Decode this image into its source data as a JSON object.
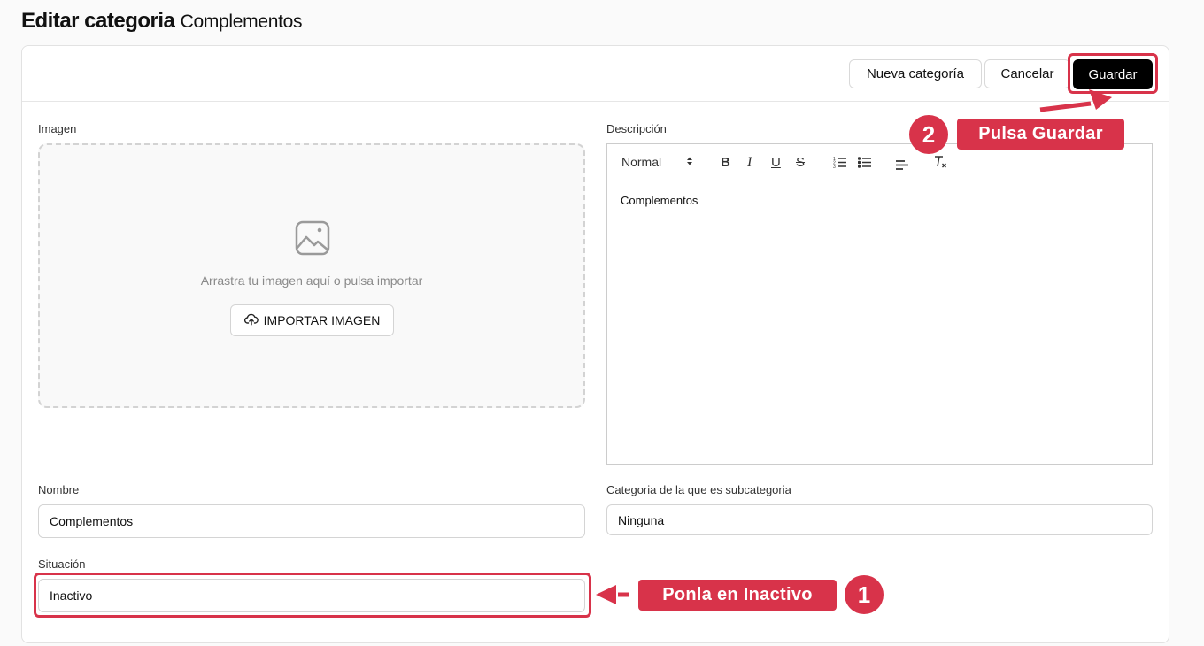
{
  "page": {
    "title": "Editar categoria",
    "subtitle": "Complementos"
  },
  "header_buttons": {
    "new_category": "Nueva categoría",
    "cancel": "Cancelar",
    "save": "Guardar"
  },
  "image": {
    "label": "Imagen",
    "dropzone_text": "Arrastra tu imagen aquí o pulsa importar",
    "import_button": "IMPORTAR IMAGEN"
  },
  "description": {
    "label": "Descripción",
    "format_select": "Normal",
    "content": "Complementos"
  },
  "name": {
    "label": "Nombre",
    "value": "Complementos"
  },
  "parent_category": {
    "label": "Categoria de la que es subcategoria",
    "value": "Ninguna"
  },
  "status": {
    "label": "Situación",
    "value": "Inactivo"
  },
  "annotations": {
    "step1_text": "Ponla en Inactivo",
    "step1_number": "1",
    "step2_text": "Pulsa Guardar",
    "step2_number": "2",
    "color": "#d8334a"
  }
}
